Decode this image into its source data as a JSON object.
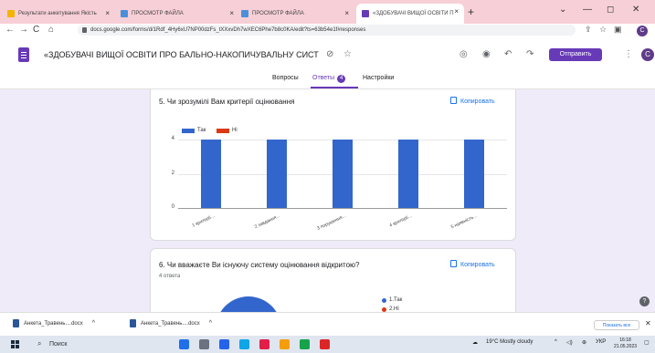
{
  "browser": {
    "tabs": [
      {
        "label": "Результати анкетування Якість",
        "fav_color": "#f4b400",
        "active": false
      },
      {
        "label": "ПРОСМОТР ФАЙЛА",
        "fav_color": "#4a90d9",
        "active": false
      },
      {
        "label": "ПРОСМОТР ФАЙЛА",
        "fav_color": "#4a90d9",
        "active": false
      },
      {
        "label": "«ЗДОБУВАЧІ ВИЩОЇ ОСВІТИ П",
        "fav_color": "#673ab7",
        "active": true
      }
    ],
    "new_tab": "+",
    "url": "docs.google.com/forms/d/1Rdf_4Hy6xU7NP00dzFs_tXXxvDh7wXEC6Phe7b8c0KA/edit?ts=63b54e1f#responses",
    "profile_letter": "C",
    "win_controls": [
      "⌄",
      "—",
      "◻",
      "✕"
    ]
  },
  "form": {
    "title": "«ЗДОБУВАЧІ ВИЩОЇ ОСВІТИ ПРО БАЛЬНО-НАКОПИЧУВАЛЬНУ СИСТ",
    "send_label": "Отправить",
    "avatar_letter": "C",
    "tabs": {
      "questions": "Вопросы",
      "answers": "Ответы",
      "answers_count": "4",
      "settings": "Настройки"
    }
  },
  "question5": {
    "title": "5. Чи зрозумілі Вам критерії оцінювання",
    "copy_label": "Копировать"
  },
  "question6": {
    "title": "6. Чи вважаєте Ви існуючу систему оцінювання відкритою?",
    "count": "4 ответа",
    "copy_label": "Копировать",
    "legend": [
      {
        "name": "1.Так",
        "color": "#3366cc"
      },
      {
        "name": "2.Ні",
        "color": "#dc3912"
      }
    ]
  },
  "chart_data": {
    "type": "bar",
    "categories": [
      "1 критерії...",
      "2 завдання...",
      "3 порушення...",
      "4 критерії...",
      "5 наявність..."
    ],
    "series": [
      {
        "name": "Так",
        "color": "#3366cc",
        "values": [
          4,
          4,
          4,
          4,
          4
        ]
      },
      {
        "name": "Ні",
        "color": "#dc3912",
        "values": [
          0,
          0,
          0,
          0,
          0
        ]
      }
    ],
    "yticks": [
      "0",
      "2",
      "4"
    ],
    "ylim": [
      0,
      4
    ],
    "legend_position": "top-left",
    "grid": true
  },
  "downloads": {
    "items": [
      "Анкета_Травень....docx",
      "Анкета_Травень....docx"
    ],
    "show_all": "Показать все",
    "close": "✕"
  },
  "taskbar": {
    "search_placeholder": "Поиск",
    "weather": "19°C Mostly cloudy",
    "lang": "УКР",
    "time": "16:18",
    "date": "21.05.2023",
    "apps": [
      "#1f6feb",
      "#6b7280",
      "#2563eb",
      "#0ea5e9",
      "#e11d48",
      "#f59e0b",
      "#16a34a",
      "#dc2626"
    ]
  }
}
